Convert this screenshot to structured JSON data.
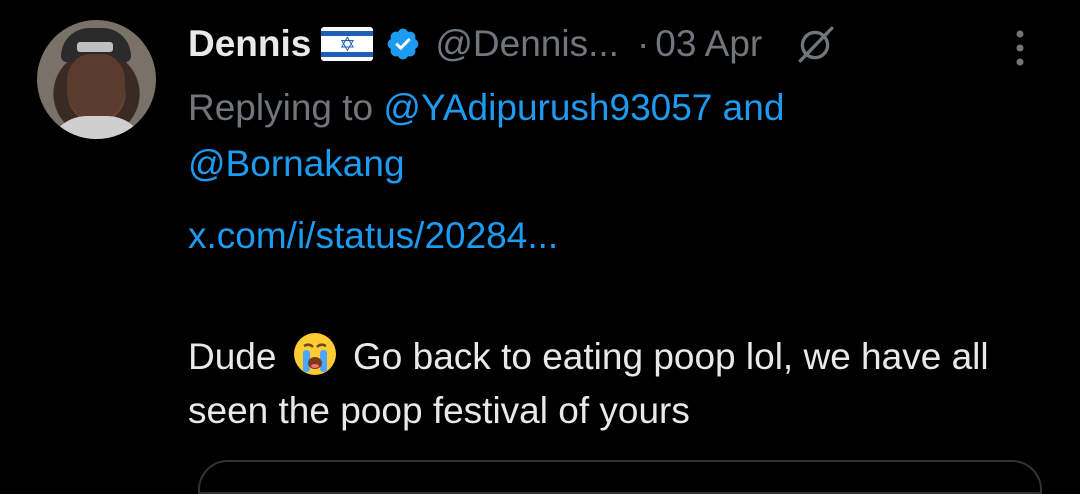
{
  "tweet": {
    "author_name": "Dennis",
    "author_flag": "israel-flag",
    "handle": "@Dennis...",
    "separator": "·",
    "date": "03 Apr",
    "replying_prefix": "Replying to",
    "mention_1": "@YAdipurush93057",
    "and_word": "and",
    "mention_2": "@Bornakang",
    "link": "x.com/i/status/20284...",
    "text_before_emoji": "Dude",
    "emoji": "loudly-crying-face",
    "text_after_emoji": "Go back to eating poop lol, we have all seen the poop festival of yours"
  },
  "colors": {
    "background": "#000000",
    "primary_text": "#e7e9ea",
    "secondary_text": "#71767b",
    "accent": "#1d9bf0"
  }
}
